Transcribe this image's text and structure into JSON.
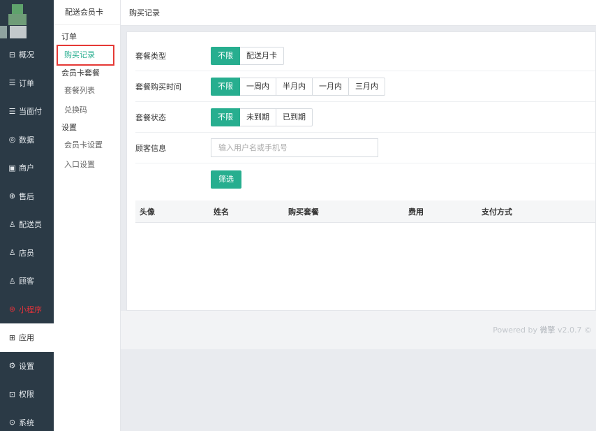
{
  "nav": {
    "items": [
      {
        "label": "概况",
        "icon": "overview-icon"
      },
      {
        "label": "订单",
        "icon": "order-icon"
      },
      {
        "label": "当面付",
        "icon": "pay-icon"
      },
      {
        "label": "数据",
        "icon": "data-icon"
      },
      {
        "label": "商户",
        "icon": "store-icon"
      },
      {
        "label": "售后",
        "icon": "aftersale-icon"
      },
      {
        "label": "配送员",
        "icon": "courier-icon"
      },
      {
        "label": "店员",
        "icon": "clerk-icon"
      },
      {
        "label": "顾客",
        "icon": "customer-icon"
      },
      {
        "label": "小程序",
        "icon": "miniprogram-icon"
      },
      {
        "label": "应用",
        "icon": "apps-icon"
      },
      {
        "label": "设置",
        "icon": "settings-icon"
      },
      {
        "label": "权限",
        "icon": "lock-icon"
      },
      {
        "label": "系统",
        "icon": "system-icon"
      }
    ],
    "accent_red": "#e0323a",
    "background": "#2b3a46"
  },
  "subnav": {
    "title": "配送会员卡",
    "group_order": "订单",
    "item_purchase": "购买记录",
    "group_card": "会员卡套餐",
    "item_package_list": "套餐列表",
    "item_redeem": "兑换码",
    "group_settings": "设置",
    "item_card_settings": "会员卡设置",
    "item_entry_settings": "入口设置"
  },
  "page": {
    "title": "购买记录"
  },
  "filters": {
    "type_label": "套餐类型",
    "type_options": [
      "不限",
      "配送月卡"
    ],
    "time_label": "套餐购买时间",
    "time_options": [
      "不限",
      "一周内",
      "半月内",
      "一月内",
      "三月内"
    ],
    "status_label": "套餐状态",
    "status_options": [
      "不限",
      "未到期",
      "已到期"
    ],
    "customer_label": "顾客信息",
    "customer_placeholder": "输入用户名或手机号",
    "filter_button": "筛选",
    "accent": "#27ae8f"
  },
  "table": {
    "columns": [
      "头像",
      "姓名",
      "购买套餐",
      "费用",
      "支付方式"
    ]
  },
  "footer": {
    "powered_by": "Powered by",
    "brand": "微擎",
    "version": "v2.0.7 ©"
  }
}
